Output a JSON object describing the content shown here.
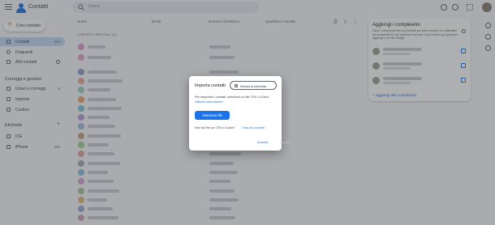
{
  "app": {
    "title": "Contatti"
  },
  "search": {
    "placeholder": "Cerca"
  },
  "sidebar": {
    "create_label": "Crea contatto",
    "items": [
      {
        "label": "Contatti",
        "count": "244"
      },
      {
        "label": "Frequenti",
        "count": ""
      },
      {
        "label": "Altri contatti",
        "count": ""
      }
    ],
    "fix_heading": "Correggi e gestisci",
    "fix_items": [
      {
        "label": "Unisci e correggi",
        "count": "5"
      },
      {
        "label": "Importa",
        "count": ""
      },
      {
        "label": "Cestino",
        "count": ""
      }
    ],
    "labels_heading": "Etichette",
    "label_items": [
      {
        "label": "ICE",
        "count": ""
      },
      {
        "label": "iPhone",
        "count": "243"
      }
    ]
  },
  "list": {
    "columns": [
      "Nome",
      "Email",
      "Numero di telefono",
      "Qualifica e società"
    ],
    "section_label": "CONTATTI SPECIALI (2)"
  },
  "panel": {
    "title": "Aggiungi i compleanni",
    "description": "Salva i compleanni dei tuoi contatti per avere avvisi e un calendario dei compleanni e non perderne mai uno: li puoi vedere qui quando li aggiungi o nel file Google.",
    "link": "+ Aggiungi altri compleanni"
  },
  "dialog": {
    "title": "Importa contatti",
    "chip_label": "Nessuna etichetta",
    "instruction": "Per importare i contatti, seleziona un file CSV o vCard.",
    "more_link": "Ulteriori informazioni",
    "select_button": "Seleziona file",
    "question": "Non hai file un CSV o vCard?",
    "create_link": "Crea più contatti",
    "cancel": "Annulla",
    "import": "Importa"
  },
  "colors": {
    "accent": "#1a73e8",
    "sidebar_active": "#c2d7f6",
    "scrim": "#3c4043"
  }
}
